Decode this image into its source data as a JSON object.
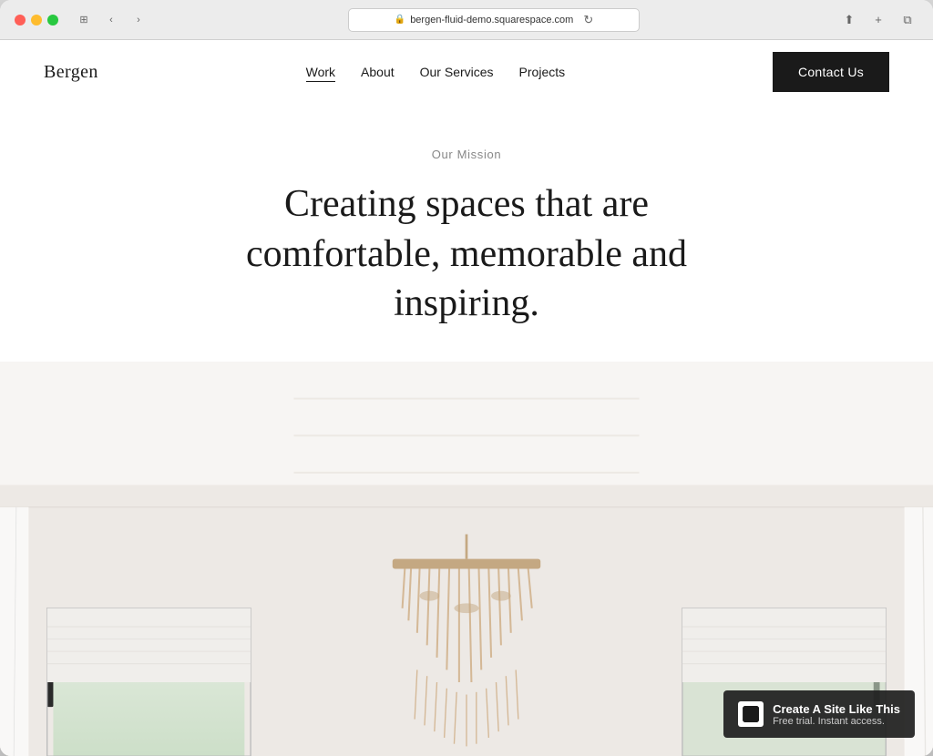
{
  "browser": {
    "url": "bergen-fluid-demo.squarespace.com",
    "traffic_lights": [
      "red",
      "yellow",
      "green"
    ]
  },
  "site": {
    "logo": "Bergen",
    "nav": {
      "links": [
        {
          "label": "Work",
          "active": true
        },
        {
          "label": "About",
          "active": false
        },
        {
          "label": "Our Services",
          "active": false
        },
        {
          "label": "Projects",
          "active": false
        }
      ],
      "cta": "Contact Us"
    },
    "hero": {
      "mission_label": "Our Mission",
      "headline": "Creating spaces that are comfortable, memorable and inspiring."
    },
    "squarespace_banner": {
      "title": "Create A Site Like This",
      "subtitle": "Free trial. Instant access."
    }
  }
}
